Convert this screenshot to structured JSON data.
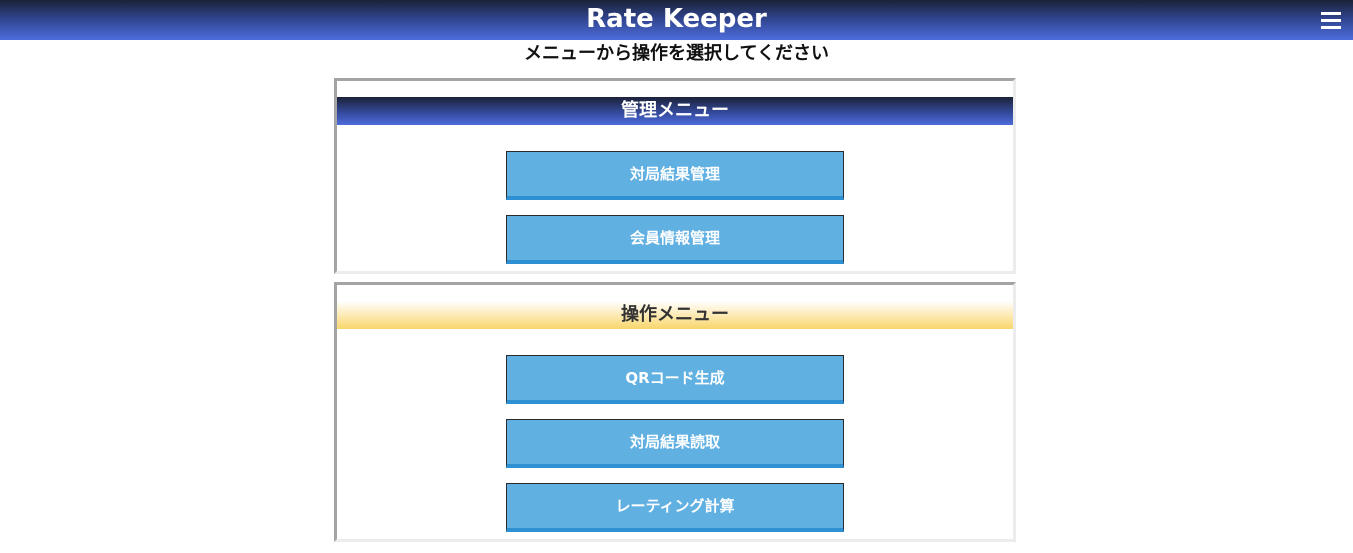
{
  "header": {
    "title": "Rate Keeper",
    "menu_icon": "hamburger-menu-icon"
  },
  "subtitle": "メニューから操作を選択してください",
  "admin_menu": {
    "title": "管理メニュー",
    "buttons": [
      {
        "label": "対局結果管理"
      },
      {
        "label": "会員情報管理"
      }
    ]
  },
  "operation_menu": {
    "title": "操作メニュー",
    "buttons": [
      {
        "label": "QRコード生成"
      },
      {
        "label": "対局結果読取"
      },
      {
        "label": "レーティング計算"
      }
    ]
  },
  "colors": {
    "header_dark": "#2f438c",
    "header_light": "#4d6ddc",
    "gold_header": "#f8d66a",
    "button": "#61b0e2",
    "button_shadow": "#2e8fd2"
  }
}
